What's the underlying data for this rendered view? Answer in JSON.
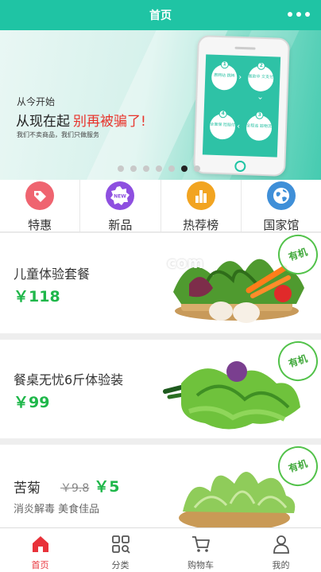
{
  "header": {
    "title": "首页"
  },
  "banner": {
    "line1": "从今开始",
    "line2_black": "从现在起",
    "line2_red": "别再被骗了!",
    "line3": "我们不卖商品，我们只做服务",
    "steps": [
      {
        "num": "1",
        "text": "惠网站 跳转"
      },
      {
        "num": "2",
        "text": "暂款中 文支付"
      },
      {
        "num": "3",
        "text": "全程追 踪物流"
      },
      {
        "num": "4",
        "text": "全面保 险赔付"
      }
    ],
    "slide_count": 7,
    "active_slide_index": 5
  },
  "categories": [
    {
      "label": "特惠",
      "icon": "tag-icon",
      "color": "#ef6470"
    },
    {
      "label": "新品",
      "icon": "new-badge-icon",
      "color": "#8e4fe0"
    },
    {
      "label": "热荐榜",
      "icon": "bar-chart-icon",
      "color": "#f2a421"
    },
    {
      "label": "国家馆",
      "icon": "globe-icon",
      "color": "#3f8fd8"
    }
  ],
  "products": [
    {
      "name": "儿童体验套餐",
      "price": "￥118",
      "badge": "有机",
      "image": "vegetable-basket-with-eggs"
    },
    {
      "name": "餐桌无忧6斤体验装",
      "price": "￥99",
      "badge": "有机",
      "image": "mixed-leafy-greens"
    },
    {
      "name": "苦菊",
      "old_price": "￥9.8",
      "price": "￥5",
      "desc": "消炎解毒  美食佳品",
      "badge": "有机",
      "image": "frisee-in-basket"
    }
  ],
  "watermark": "com",
  "tabbar": [
    {
      "label": "首页",
      "icon": "home-icon",
      "active": true
    },
    {
      "label": "分类",
      "icon": "category-grid-icon",
      "active": false
    },
    {
      "label": "购物车",
      "icon": "cart-icon",
      "active": false
    },
    {
      "label": "我的",
      "icon": "user-icon",
      "active": false
    }
  ],
  "colors": {
    "brand": "#1fc4a4",
    "price": "#1fb74a",
    "active_tab": "#e8323a",
    "badge": "#52c24a"
  }
}
